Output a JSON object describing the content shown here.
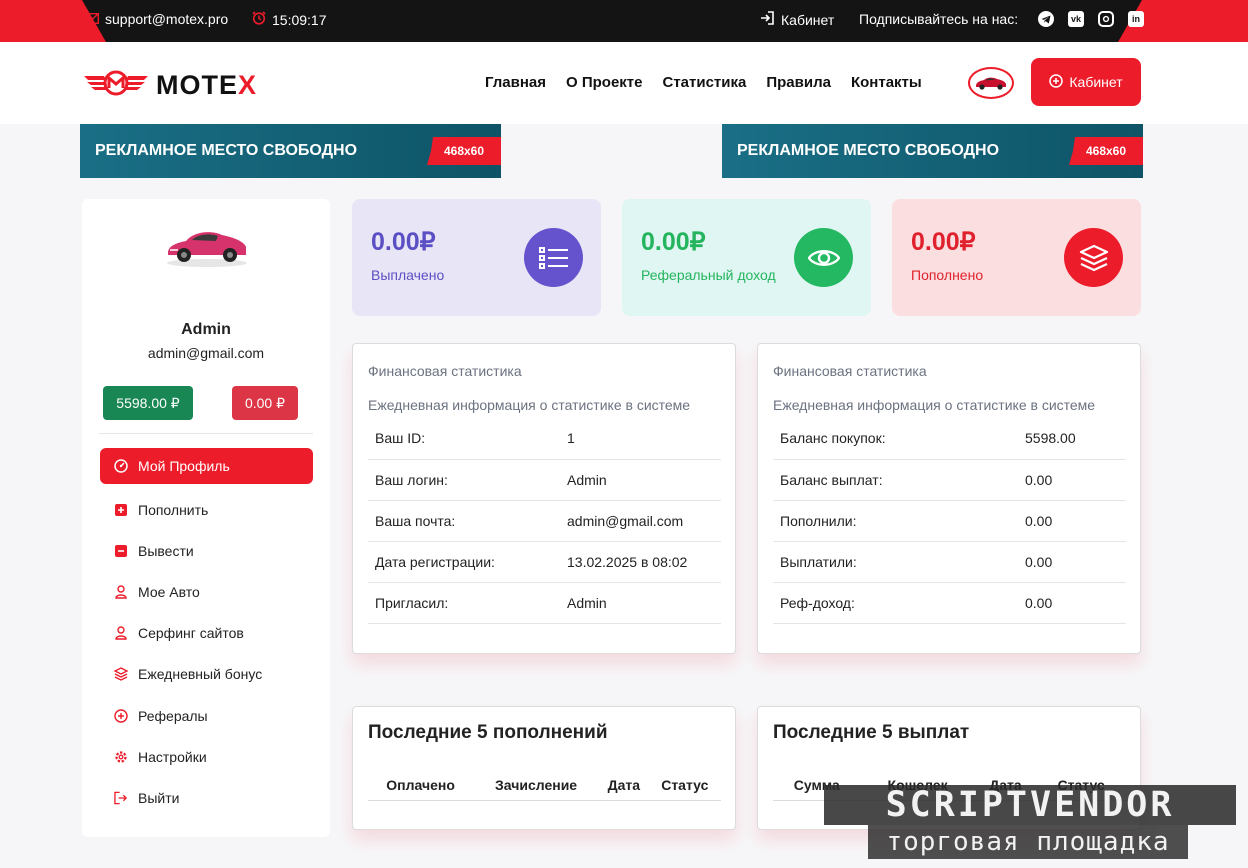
{
  "topbar": {
    "email": "support@motex.pro",
    "time": "15:09:17",
    "cabinet_link": "Кабинет",
    "subscribe": "Подписывайтесь на нас:",
    "socials": [
      "telegram-icon",
      "vk-icon",
      "instagram-icon",
      "linkedin-icon"
    ]
  },
  "header": {
    "logo_text_a": "MOTE",
    "logo_text_b": "X",
    "nav": [
      "Главная",
      "О Проекте",
      "Статистика",
      "Правила",
      "Контакты"
    ],
    "cabinet_button": "Кабинет"
  },
  "ads": {
    "left": {
      "text": "РЕКЛАМНОЕ  МЕСТО СВОБОДНО",
      "size": "468x60"
    },
    "right": {
      "text": "РЕКЛАМНОЕ  МЕСТО СВОБОДНО",
      "size": "468x60"
    }
  },
  "sidebar": {
    "name": "Admin",
    "email": "admin@gmail.com",
    "balance_green": "5598.00 ₽",
    "balance_red": "0.00 ₽",
    "menu": [
      {
        "label": "Мой Профиль",
        "icon": "dashboard-icon"
      },
      {
        "label": "Пополнить",
        "icon": "plus-square-icon"
      },
      {
        "label": "Вывести",
        "icon": "minus-square-icon"
      },
      {
        "label": "Мое Авто",
        "icon": "user-icon"
      },
      {
        "label": "Серфинг сайтов",
        "icon": "user-icon"
      },
      {
        "label": "Ежедневный бонус",
        "icon": "layers-icon"
      },
      {
        "label": "Рефералы",
        "icon": "plus-circle-icon"
      },
      {
        "label": "Настройки",
        "icon": "gear-icon"
      },
      {
        "label": "Выйти",
        "icon": "logout-icon"
      }
    ]
  },
  "stats": [
    {
      "value": "0.00₽",
      "label": "Выплачено",
      "icon": "list-icon",
      "color": "#6453cc"
    },
    {
      "value": "0.00₽",
      "label": "Реферальный доход",
      "icon": "eye-icon",
      "color": "#25b862"
    },
    {
      "value": "0.00₽",
      "label": "Пополнено",
      "icon": "layers-icon",
      "color": "#ed1c2a"
    }
  ],
  "finance_left": {
    "title": "Финансовая статистика",
    "subtitle": "Ежедневная информация о статистике в системе",
    "rows": [
      [
        "Ваш ID:",
        "1"
      ],
      [
        "Ваш логин:",
        "Admin"
      ],
      [
        "Ваша почта:",
        "admin@gmail.com"
      ],
      [
        "Дата регистрации:",
        "13.02.2025 в 08:02"
      ],
      [
        "Пригласил:",
        "Admin"
      ]
    ]
  },
  "finance_right": {
    "title": "Финансовая статистика",
    "subtitle": "Ежедневная информация о статистике в системе",
    "rows": [
      [
        "Баланс покупок:",
        "5598.00"
      ],
      [
        "Баланс выплат:",
        "0.00"
      ],
      [
        "Пополнили:",
        "0.00"
      ],
      [
        "Выплатили:",
        "0.00"
      ],
      [
        "Реф-доход:",
        "0.00"
      ]
    ]
  },
  "last_deposits": {
    "title": "Последние 5 пополнений",
    "columns": [
      "Оплачено",
      "Зачисление",
      "Дата",
      "Статус"
    ]
  },
  "last_payouts": {
    "title": "Последние 5 выплат",
    "columns": [
      "Сумма",
      "Кошелек",
      "Дата",
      "Статус"
    ]
  },
  "watermark": {
    "line1": "SCRIPTVENDOR",
    "line2": "торговая площадка"
  },
  "colors": {
    "accent": "#ed1c2a",
    "dark": "#141414",
    "green": "#198754",
    "purple": "#6453cc"
  }
}
